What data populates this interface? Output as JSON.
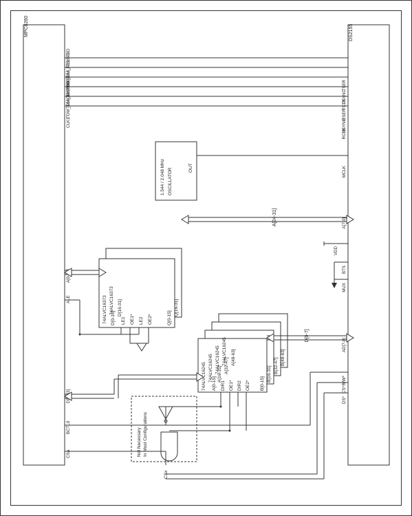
{
  "left_chip": {
    "name": "MPC8260",
    "pins": [
      "TDM_A1:L1TXD",
      "TDM_A1:L1TSYNC",
      "CLK2",
      "TDM_A1:L1RXD",
      "TDM_A1:L1RSYNC",
      "CLK1",
      "",
      "A[0-31]",
      "ALE",
      "",
      "D[0-63]",
      "BCTL0",
      "CSa"
    ]
  },
  "right_chip": {
    "name": "DS2155",
    "pins": [
      "TSER",
      "TSYNC",
      "TCLK",
      "RSER",
      "RSYNC",
      "RCLK",
      "",
      "MCLK",
      "",
      "",
      "A[7-0]",
      "",
      "VDD",
      "BTS",
      "MUX",
      "",
      "AD[7-0]",
      "",
      "R/W*",
      "CS*",
      "DS*"
    ]
  },
  "osc": {
    "line1": "1.544 / 2.048 MHz",
    "line2": "OSCILLATOR",
    "out": "OUT"
  },
  "latch_group": {
    "part1": "74ALVC16373",
    "part2": "74ALVC16373",
    "sig1_d": "D[16-31]",
    "sig1_q": "Q[16-31]",
    "sig2_d": "D[0-15]",
    "sig2_q": "Q[0-15]",
    "ctrls": [
      "LE1",
      "OE1*",
      "LE2",
      "OE2*"
    ]
  },
  "xcvr_group": {
    "part": "74ALVC16245",
    "rows": [
      {
        "a": "A[48-63]",
        "b": "B[48-63]"
      },
      {
        "a": "A[32-47]",
        "b": "B[32-47]"
      },
      {
        "a": "A[16-31]",
        "b": "B[16-31]"
      },
      {
        "a": "A[0-15]",
        "b": "B[0-15]"
      }
    ],
    "ctrls": [
      "DIR1",
      "OE1*",
      "DIR2",
      "OE2*"
    ]
  },
  "note_box": {
    "l1": "Not Necessary",
    "l2": "In Most Configurations",
    "cs": "CSx"
  },
  "bus_lbl_top": "A[24-31]",
  "bus_lbl_bot": "D[0-7]"
}
